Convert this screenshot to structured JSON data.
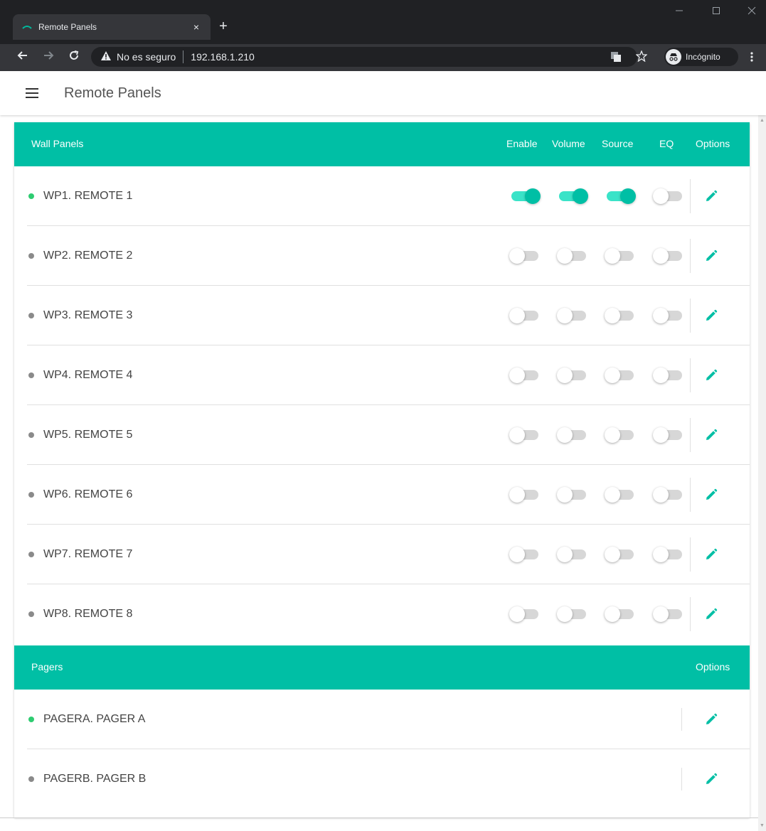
{
  "browser": {
    "tab_title": "Remote Panels",
    "tab_close": "×",
    "new_tab": "+",
    "url_warning": "No es seguro",
    "url": "192.168.1.210",
    "incognito_label": "Incógnito"
  },
  "app": {
    "title": "Remote Panels"
  },
  "wall_panels": {
    "title": "Wall Panels",
    "columns": [
      "Enable",
      "Volume",
      "Source",
      "EQ",
      "Options"
    ],
    "rows": [
      {
        "name": "WP1. REMOTE 1",
        "online": true,
        "enable": true,
        "volume": true,
        "source": true,
        "eq": false
      },
      {
        "name": "WP2. REMOTE 2",
        "online": false,
        "enable": false,
        "volume": false,
        "source": false,
        "eq": false
      },
      {
        "name": "WP3. REMOTE 3",
        "online": false,
        "enable": false,
        "volume": false,
        "source": false,
        "eq": false
      },
      {
        "name": "WP4. REMOTE 4",
        "online": false,
        "enable": false,
        "volume": false,
        "source": false,
        "eq": false
      },
      {
        "name": "WP5. REMOTE 5",
        "online": false,
        "enable": false,
        "volume": false,
        "source": false,
        "eq": false
      },
      {
        "name": "WP6. REMOTE 6",
        "online": false,
        "enable": false,
        "volume": false,
        "source": false,
        "eq": false
      },
      {
        "name": "WP7. REMOTE 7",
        "online": false,
        "enable": false,
        "volume": false,
        "source": false,
        "eq": false
      },
      {
        "name": "WP8. REMOTE 8",
        "online": false,
        "enable": false,
        "volume": false,
        "source": false,
        "eq": false
      }
    ]
  },
  "pagers": {
    "title": "Pagers",
    "options_label": "Options",
    "rows": [
      {
        "name": "PAGERA. PAGER A",
        "online": true
      },
      {
        "name": "PAGERB. PAGER B",
        "online": false
      }
    ]
  },
  "colors": {
    "accent": "#00bfa5",
    "online": "#2ecc71",
    "offline": "#8a8a8a",
    "edit_icon": "#00bfa5"
  }
}
